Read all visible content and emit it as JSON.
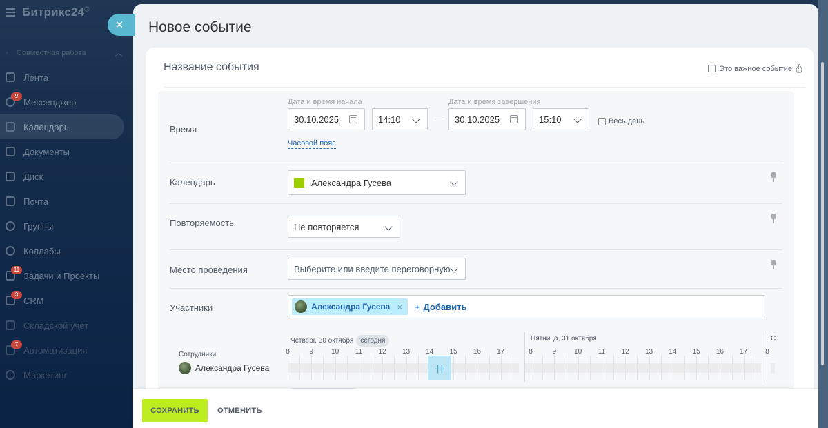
{
  "app": {
    "logo": "Битрикс24",
    "logo_mark": "©",
    "group_label": "Совместная работа"
  },
  "sidebar": {
    "items": [
      {
        "label": "Лента",
        "badge": ""
      },
      {
        "label": "Мессенджер",
        "badge": "9"
      },
      {
        "label": "Календарь",
        "badge": ""
      },
      {
        "label": "Документы",
        "badge": ""
      },
      {
        "label": "Диск",
        "badge": ""
      },
      {
        "label": "Почта",
        "badge": ""
      },
      {
        "label": "Группы",
        "badge": ""
      },
      {
        "label": "Коллабы",
        "badge": ""
      },
      {
        "label": "Задачи и Проекты",
        "badge": "11"
      },
      {
        "label": "CRM",
        "badge": "3"
      },
      {
        "label": "Складской учёт",
        "badge": ""
      },
      {
        "label": "Автоматизация",
        "badge": "7"
      },
      {
        "label": "Маркетинг",
        "badge": ""
      }
    ]
  },
  "panel": {
    "title": "Новое событие",
    "event_name_placeholder": "Название события",
    "important_label": "Это важное событие"
  },
  "time": {
    "label": "Время",
    "start_caption": "Дата и время начала",
    "end_caption": "Дата и время завершения",
    "start_date": "30.10.2025",
    "start_time": "14:10",
    "end_date": "30.10.2025",
    "end_time": "15:10",
    "allday_label": "Весь день",
    "timezone_link": "Часовой пояс",
    "dash": "—"
  },
  "calendar": {
    "label": "Календарь",
    "value": "Александра Гусева",
    "color": "#9dcf00"
  },
  "repeat": {
    "label": "Повторяемость",
    "value": "Не повторяется"
  },
  "location": {
    "label": "Место проведения",
    "placeholder": "Выберите или введите переговорную"
  },
  "attendees": {
    "label": "Участники",
    "chip": "Александра Гусева",
    "add": "Добавить"
  },
  "timeline": {
    "day1": "Четверг, 30 октября",
    "today": "сегодня",
    "day2": "Пятница, 31 октября",
    "day3": "С",
    "employees_title": "Сотрудники",
    "employee": "Александра Гусева",
    "hours_day1": [
      "8",
      "9",
      "10",
      "11",
      "12",
      "13",
      "14",
      "15",
      "16",
      "17"
    ],
    "hours_day2": [
      "8",
      "9",
      "10",
      "11",
      "12",
      "13",
      "14",
      "15",
      "16",
      "17",
      "8"
    ],
    "selection": {
      "start": "14:10",
      "end": "15:10"
    }
  },
  "footer": {
    "save": "СОХРАНИТЬ",
    "cancel": "ОТМЕНИТЬ"
  },
  "colors": {
    "accent": "#2067b0",
    "save_button": "#bbed21",
    "close_tab": "#59b8cf",
    "chip_bg": "#bcedfc",
    "selection": "#bde6f7"
  }
}
